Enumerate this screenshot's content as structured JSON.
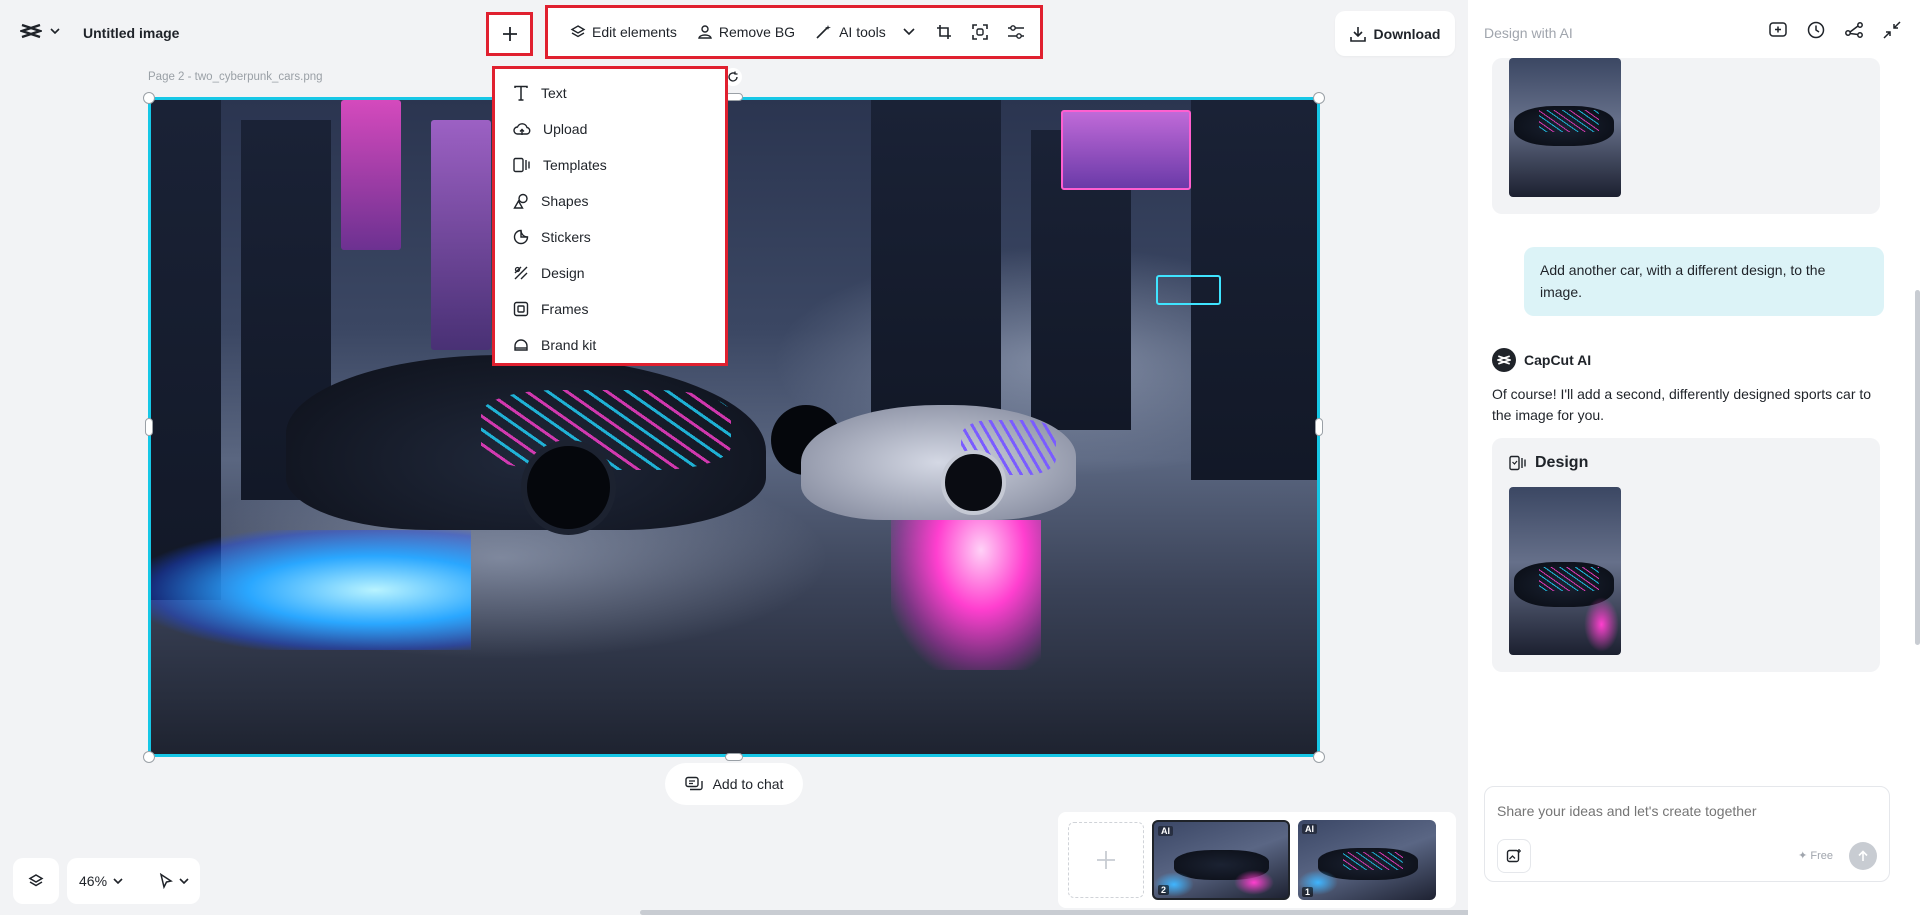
{
  "header": {
    "doc_title": "Untitled image",
    "toolbar": {
      "edit_elements": "Edit elements",
      "remove_bg": "Remove BG",
      "ai_tools": "AI tools"
    },
    "download": "Download"
  },
  "canvas": {
    "page_label": "Page 2 -  two_cyberpunk_cars.png"
  },
  "add_menu": {
    "items": [
      {
        "label": "Text",
        "icon": "text-icon"
      },
      {
        "label": "Upload",
        "icon": "upload-cloud-icon"
      },
      {
        "label": "Templates",
        "icon": "templates-icon"
      },
      {
        "label": "Shapes",
        "icon": "shapes-icon"
      },
      {
        "label": "Stickers",
        "icon": "sticker-icon"
      },
      {
        "label": "Design",
        "icon": "design-icon"
      },
      {
        "label": "Frames",
        "icon": "frame-icon"
      },
      {
        "label": "Brand kit",
        "icon": "brand-kit-icon"
      }
    ]
  },
  "add_to_chat": "Add to chat",
  "zoom": "46%",
  "pages": {
    "thumbs": [
      {
        "ai": "AI",
        "num": "2"
      },
      {
        "ai": "AI",
        "num": "1"
      }
    ]
  },
  "panel": {
    "title": "Design with AI",
    "user_message": "Add another car, with a different design, to the image.",
    "ai_name": "CapCut AI",
    "ai_message": "Of course! I'll add a second, differently designed sports car to the image for you.",
    "design_label": "Design",
    "input_placeholder": "Share your ideas and let's create together",
    "free_label": "✦ Free"
  },
  "colors": {
    "highlight": "#e0202f",
    "selection": "#16c7e6",
    "user_bubble": "#dcf3f7"
  }
}
